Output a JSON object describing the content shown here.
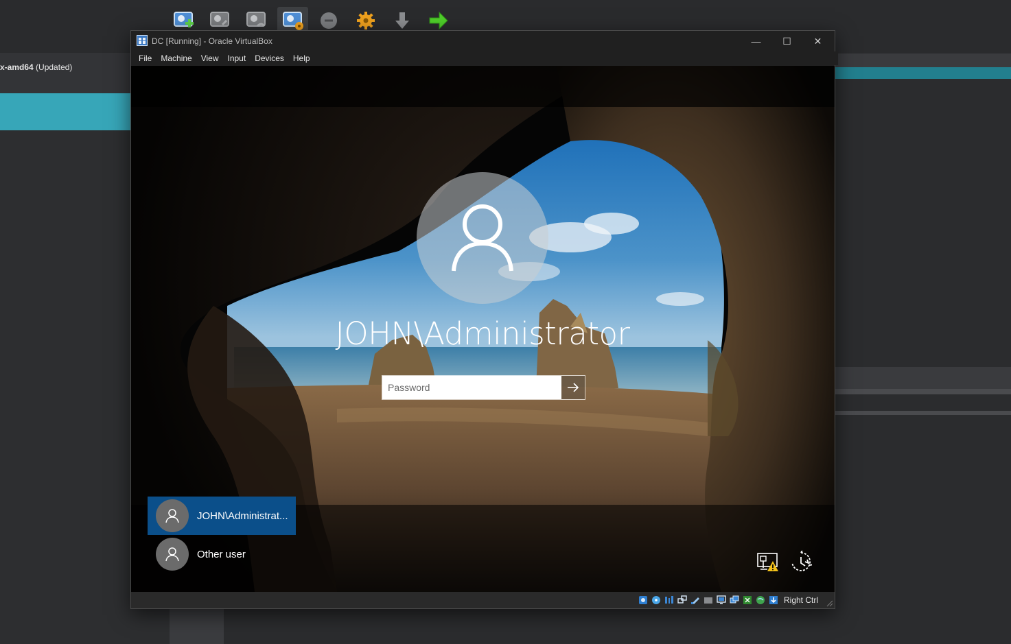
{
  "manager": {
    "vm_row_name": "x-amd64",
    "vm_row_status": "(Updated)",
    "toolbar": [
      {
        "icon": "new-vm-icon"
      },
      {
        "icon": "add-vm-icon"
      },
      {
        "icon": "import-icon"
      },
      {
        "icon": "settings-vm-icon"
      },
      {
        "icon": "discard-icon"
      },
      {
        "icon": "gear-icon"
      },
      {
        "icon": "down-arrow-icon"
      },
      {
        "icon": "start-arrow-icon"
      }
    ]
  },
  "window": {
    "title": "DC [Running] - Oracle VirtualBox",
    "minimize": "—",
    "maximize": "☐",
    "close": "✕"
  },
  "menu": [
    "File",
    "Machine",
    "View",
    "Input",
    "Devices",
    "Help"
  ],
  "login": {
    "username": "JOHN\\Administrator",
    "password_placeholder": "Password",
    "users": [
      {
        "name": "JOHN\\Administrat...",
        "selected": true
      },
      {
        "name": "Other user",
        "selected": false
      }
    ],
    "icons": [
      "network-warning-icon",
      "ease-of-access-icon"
    ]
  },
  "status": {
    "host_key": "Right Ctrl"
  },
  "colors": {
    "accent": "#37a6b8",
    "selected_tile": "#0b4f8a"
  }
}
